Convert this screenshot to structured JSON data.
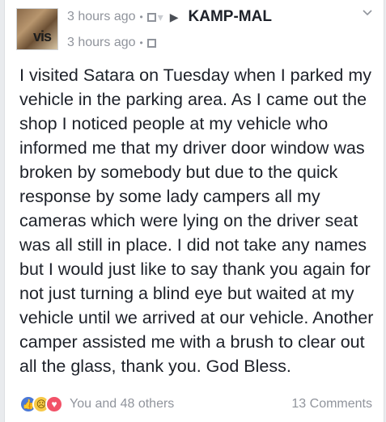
{
  "post": {
    "timestamp": "3 hours ago",
    "arrow": "▶",
    "group": "KAMP-MAL",
    "avatar_overlay": "vis",
    "text": "I visited Satara on Tuesday when I parked my vehicle in the parking area. As I came out the shop I noticed people at my vehicle who informed me that my driver door window was broken by somebody but due to the quick response by some lady campers all my cameras which were lying on the driver seat was all still in place. I did not take any names but I would just like to say thank you again for not just turning a blind eye but waited at my vehicle until we arrived at our vehicle. Another camper assisted me with a brush to clear out all the glass, thank you. God Bless."
  },
  "footer": {
    "reactions_text": "You and 48 others",
    "comments": "13 Comments"
  },
  "icons": {
    "like": "like-icon",
    "sad": "sad-icon",
    "love": "love-icon",
    "privacy": "privacy-icon",
    "chevron": "chevron-down-icon"
  }
}
